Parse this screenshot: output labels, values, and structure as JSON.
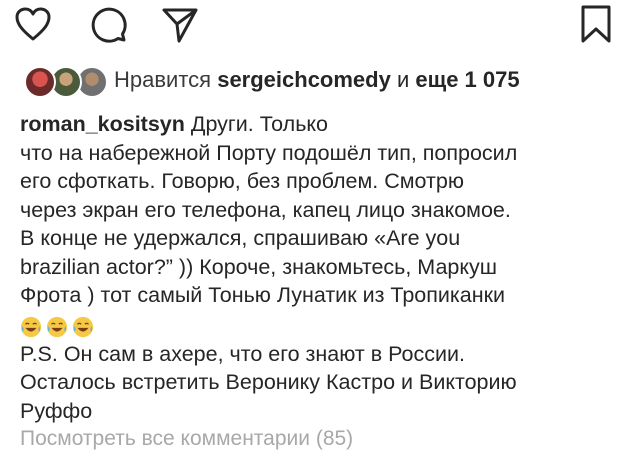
{
  "actions": {
    "like_icon": "heart-outline",
    "comment_icon": "speech-bubble",
    "share_icon": "paper-plane",
    "save_icon": "bookmark-outline"
  },
  "likes": {
    "prefix": "Нравится",
    "username": "sergeichcomedy",
    "connector": "и",
    "others": "еще 1 075"
  },
  "caption": {
    "username": "roman_kositsyn",
    "first_line_text": "Други. Только",
    "lines": [
      "что на набережной Порту подошёл тип, попросил",
      "его сфоткать. Говорю, без проблем. Смотрю",
      "через экран его телефона, капец лицо знакомое.",
      "В конце не удержался, спрашиваю «Are you",
      "brazilian actor?” )) Короче, знакомьтесь, Маркуш",
      "Фрота ) тот самый Тонью Лунатик из Тропиканки"
    ],
    "emoji_icon": "face-with-tears-of-joy",
    "ps_lines": [
      "P.S. Он сам в ахере, что его знают в России.",
      "Осталось встретить Веронику Кастро и Викторию",
      "Руффо"
    ]
  },
  "comments_link": "Посмотреть все комментарии (85)"
}
